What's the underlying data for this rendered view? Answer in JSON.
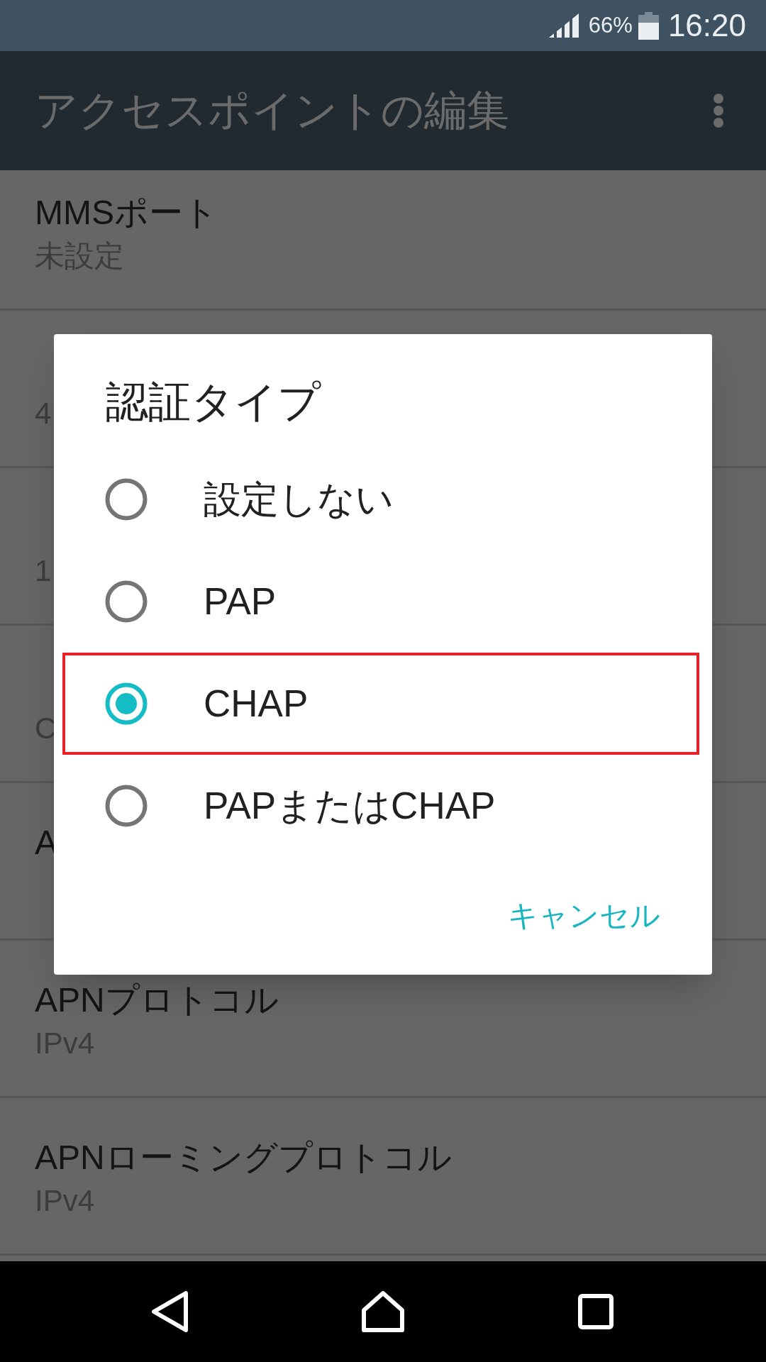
{
  "status_bar": {
    "battery": "66%",
    "time": "16:20"
  },
  "app_bar": {
    "title": "アクセスポイントの編集"
  },
  "settings": [
    {
      "title": "MMSポート",
      "value": "未設定"
    },
    {
      "value": "4"
    },
    {
      "value": "1"
    },
    {
      "value": "C"
    },
    {
      "title": "A"
    },
    {
      "title": "APNプロトコル",
      "value": "IPv4"
    },
    {
      "title": "APNローミングプロトコル",
      "value": "IPv4"
    }
  ],
  "dialog": {
    "title": "認証タイプ",
    "options": [
      {
        "label": "設定しない",
        "selected": false,
        "outlined": false
      },
      {
        "label": "PAP",
        "selected": false,
        "outlined": false
      },
      {
        "label": "CHAP",
        "selected": true,
        "outlined": true
      },
      {
        "label": "PAPまたはCHAP",
        "selected": false,
        "outlined": false
      }
    ],
    "buttons": [
      {
        "label": "キャンセル"
      }
    ]
  }
}
